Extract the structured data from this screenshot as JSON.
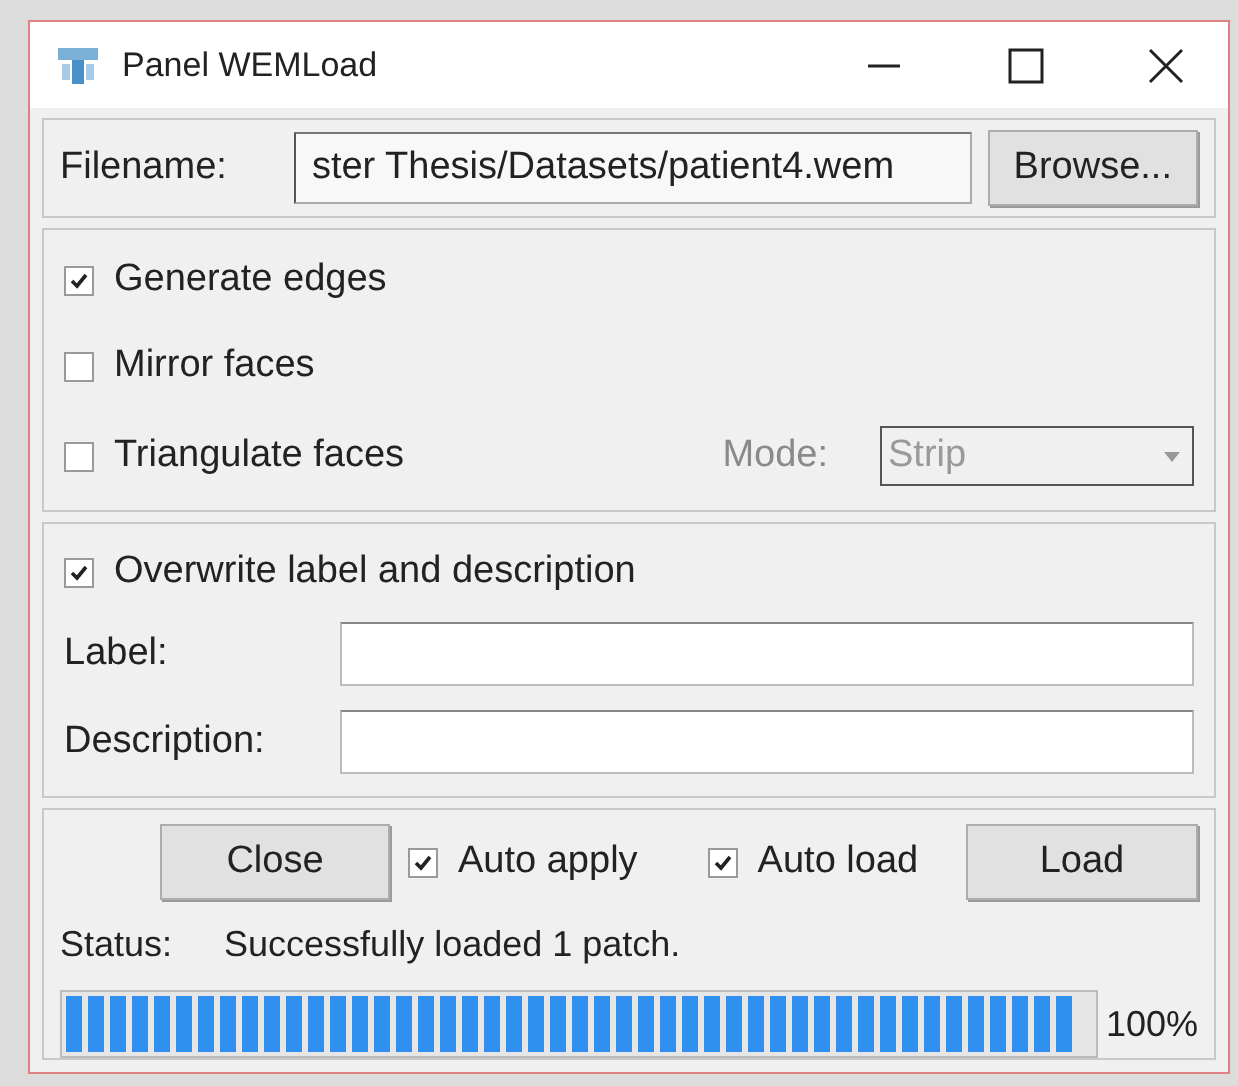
{
  "window": {
    "title": "Panel WEMLoad"
  },
  "file": {
    "label": "Filename:",
    "value": "ster Thesis/Datasets/patient4.wem",
    "button": "Browse..."
  },
  "options": [
    {
      "label": "Generate edges",
      "checked": true
    },
    {
      "label": "Mirror faces",
      "checked": false
    },
    {
      "label": "Triangulate faces",
      "checked": false
    }
  ],
  "mode": {
    "label": "Mode:",
    "value": "Strip",
    "disabled": true
  },
  "overwrite": {
    "label": "Overwrite label and description",
    "checked": true
  },
  "fields": [
    {
      "label": "Label:"
    },
    {
      "label": "Description:"
    }
  ],
  "actions": {
    "close": "Close",
    "load": "Load",
    "toggles": [
      {
        "label": "Auto apply",
        "checked": true
      },
      {
        "label": "Auto load",
        "checked": true
      }
    ]
  },
  "status": {
    "label": "Status:",
    "text": "Successfully loaded 1 patch."
  },
  "progress": {
    "level": 1,
    "reading": "100%"
  }
}
